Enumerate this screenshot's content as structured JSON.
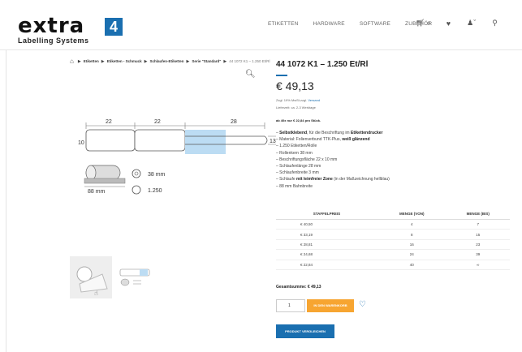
{
  "brand": {
    "logo_text": "extra",
    "logo_box": "4",
    "logo_sub": "Labelling Systems"
  },
  "nav": {
    "items": [
      "ETIKETTEN",
      "HARDWARE",
      "SOFTWARE",
      "ZUBEHÖR"
    ],
    "cart_count": "0",
    "icons": [
      "cart-icon",
      "heart-icon",
      "user-icon",
      "search-icon"
    ]
  },
  "breadcrumb": {
    "items": [
      "Etiketten",
      "Etiketten - Schmuck",
      "Schlaufen-Etiketten",
      "Serie \"Standard\""
    ],
    "current": "44 1072 K1 – 1.250 Et/Rl"
  },
  "drawing": {
    "dim1": "22",
    "dim2": "22",
    "dim3": "28",
    "height": "10",
    "end": "13",
    "core_width": "88 mm",
    "core_diameter": "38 mm",
    "labels_per_roll": "1.250"
  },
  "product": {
    "title": "44 1072 K1 – 1.250 Et/Rl",
    "price": "€ 49,13",
    "tax_prefix": "Zzgl. 19% MwSt.zzgl.",
    "tax_link": "Versand",
    "delivery": "Lieferzeit: ca. 2-3 Werktage",
    "from_price": "ab 40x nur € 22,84 pro Stück.",
    "features": [
      {
        "bold": "Selbstklebend",
        "text": ", für die Beschriftung im ",
        "bold2": "Etikettendrucker",
        "text2": ""
      },
      {
        "bold": "",
        "text": "Material: Folienverbund TTK-Plus, ",
        "bold2": "weiß glänzend",
        "text2": ""
      },
      {
        "bold": "",
        "text": "1.250 Etiketten/Rolle",
        "bold2": "",
        "text2": ""
      },
      {
        "bold": "",
        "text": "Rollenkern 38 mm",
        "bold2": "",
        "text2": ""
      },
      {
        "bold": "",
        "text": "Beschriftungsfläche 22 x 10 mm",
        "bold2": "",
        "text2": ""
      },
      {
        "bold": "",
        "text": "Schlaufenlänge 28 mm",
        "bold2": "",
        "text2": ""
      },
      {
        "bold": "",
        "text": "Schlaufenbreite 3 mm",
        "bold2": "",
        "text2": ""
      },
      {
        "bold": "",
        "text": "Schlaufe ",
        "bold2": "mit leimfreier Zone",
        "text2": " (in der Maßzeichnung hellblau)"
      },
      {
        "bold": "",
        "text": "88 mm Bahnbreite",
        "bold2": "",
        "text2": ""
      }
    ]
  },
  "price_table": {
    "headers": [
      "STAFFELPREIS",
      "MENGE (VON)",
      "MENGE (BIS)"
    ],
    "rows": [
      [
        "€ 40,50",
        "4",
        "7"
      ],
      [
        "€ 33,19",
        "8",
        "15"
      ],
      [
        "€ 28,81",
        "16",
        "23"
      ],
      [
        "€ 24,68",
        "24",
        "39"
      ],
      [
        "€ 22,84",
        "40",
        "∞"
      ]
    ]
  },
  "order": {
    "total": "Gesamtsumme: € 49,13",
    "quantity": "1",
    "cart_button": "IN DEN WARENKORB",
    "compare_button": "PRODUKT VERGLEICHEN"
  },
  "colors": {
    "accent": "#1a6fb0",
    "cart_button": "#f7a531",
    "glue_free_zone": "#bcdcf3"
  }
}
